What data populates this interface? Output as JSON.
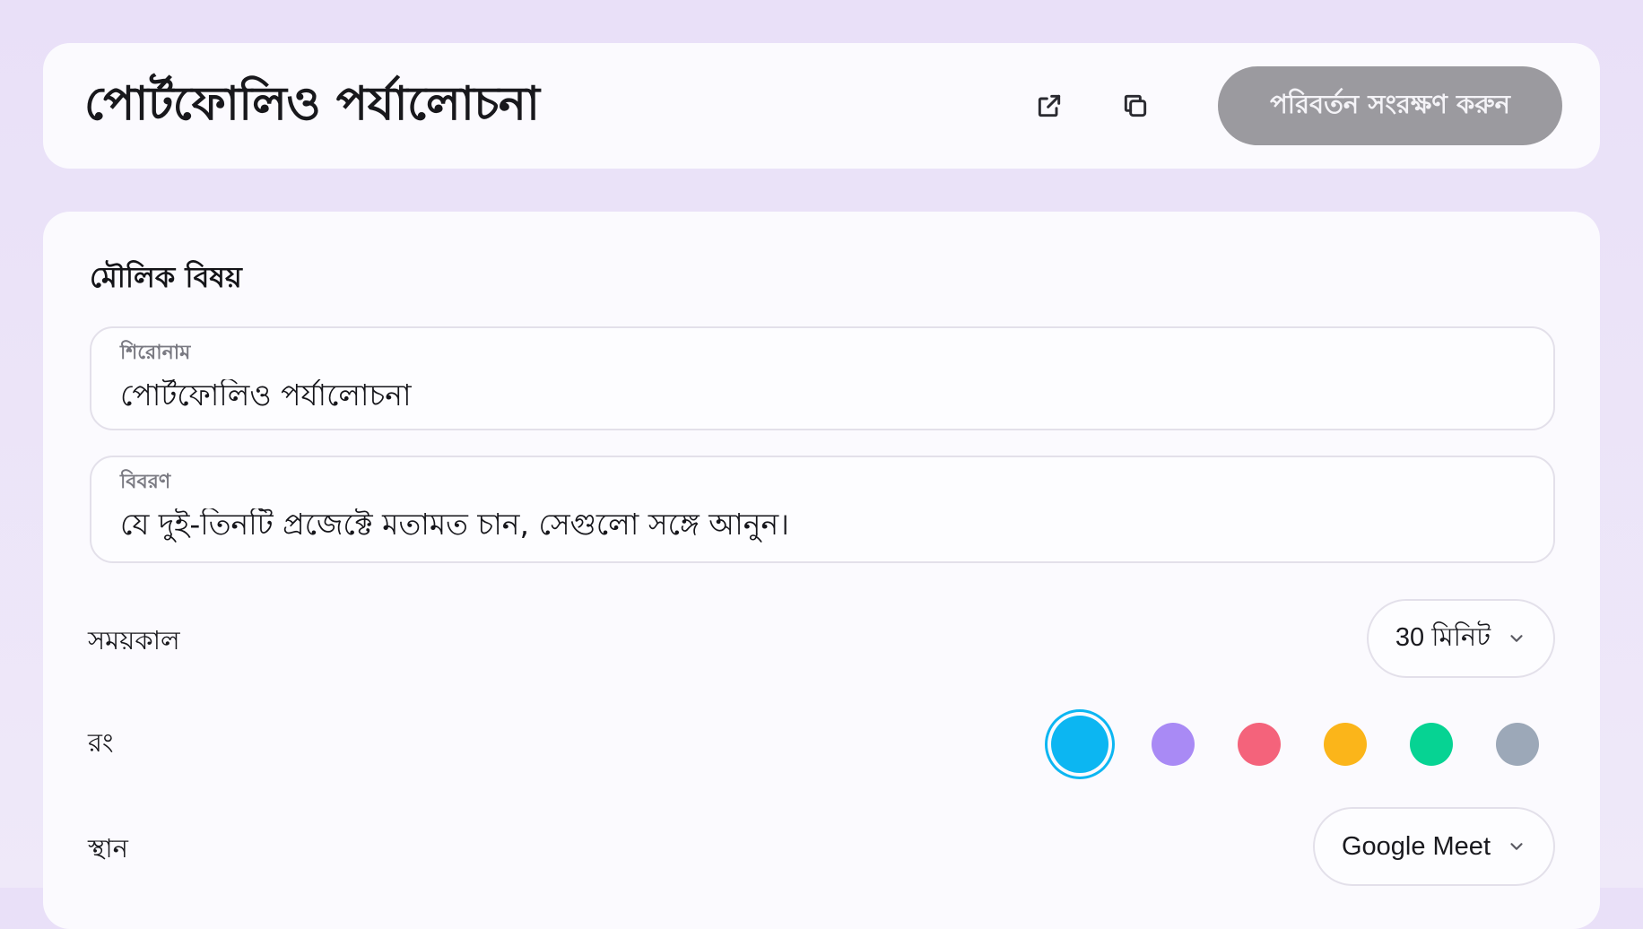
{
  "header": {
    "title": "পোর্টফোলিও পর্যালোচনা",
    "save_label": "পরিবর্তন সংরক্ষণ করুন",
    "open_icon": "external-link-icon",
    "copy_icon": "copy-icon"
  },
  "basics": {
    "section_title": "মৌলিক বিষয়",
    "title_label": "শিরোনাম",
    "title_value": "পোর্টফোলিও পর্যালোচনা",
    "description_label": "বিবরণ",
    "description_value": "যে দুই-তিনটি প্রজেক্টে মতামত চান, সেগুলো সঙ্গে আনুন।",
    "duration_label": "সময়কাল",
    "duration_value": "30 মিনিট",
    "color_label": "রং",
    "colors": [
      "#0cb6f2",
      "#a98af5",
      "#f4637b",
      "#fbb51a",
      "#06d393",
      "#9ca8b8"
    ],
    "selected_color": "#0cb6f2",
    "location_label": "স্থান",
    "location_value": "Google Meet"
  }
}
